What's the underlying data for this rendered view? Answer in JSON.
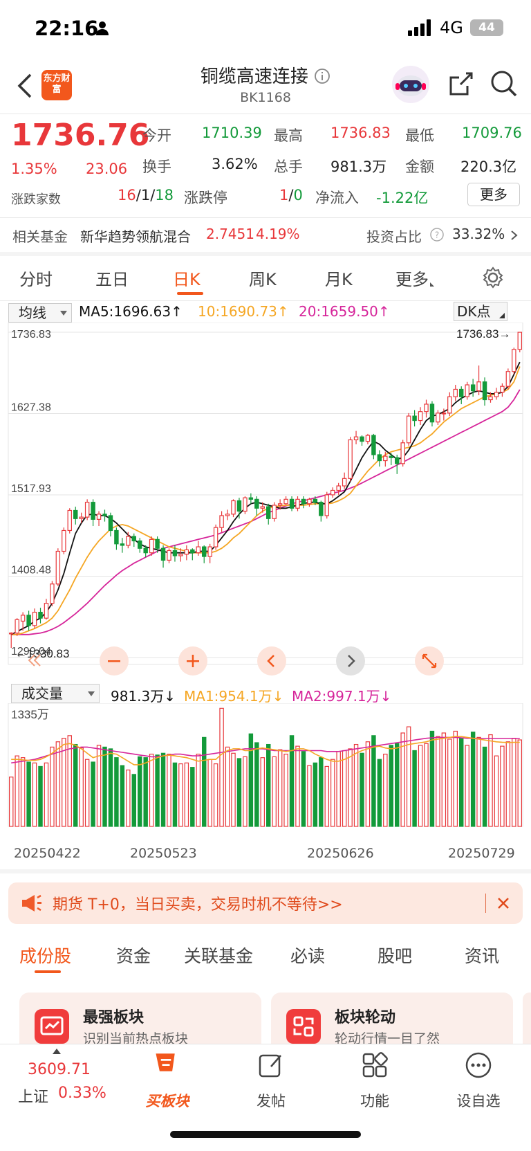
{
  "status_bar": {
    "time": "22:16",
    "network": "4G",
    "battery": "44"
  },
  "header": {
    "logo_text": "东方财富",
    "title": "铜缆高速连接",
    "code": "BK1168"
  },
  "quote": {
    "price": "1736.76",
    "change_pct": "1.35%",
    "change": "23.06",
    "open_label": "今开",
    "open": "1710.39",
    "high_label": "最高",
    "high": "1736.83",
    "low_label": "最低",
    "low": "1709.76",
    "turnover_label": "换手",
    "turnover": "3.62%",
    "volume_label": "总手",
    "volume": "981.3万",
    "amount_label": "金额",
    "amount": "220.3亿",
    "breadth_label": "涨跌家数",
    "breadth_up": "16",
    "breadth_flat": "1",
    "breadth_down": "18",
    "limit_label": "涨跌停",
    "limit_up": "1",
    "limit_down": "0",
    "netflow_label": "净流入",
    "netflow": "-1.22亿",
    "more_label": "更多"
  },
  "fund": {
    "label": "相关基金",
    "name": "新华趋势领航混合",
    "nav": "2.7451",
    "pct": "4.19%",
    "ratio_label": "投资占比",
    "ratio": "33.32%"
  },
  "tabs": [
    "分时",
    "五日",
    "日K",
    "周K",
    "月K",
    "更多"
  ],
  "active_tab": 2,
  "ma": {
    "selector": "均线",
    "ma5": "MA5:1696.63↑",
    "ma10": "10:1690.73↑",
    "ma20": "20:1659.50↑",
    "dk": "DK点"
  },
  "axis": {
    "y_ticks": [
      "1736.83",
      "1627.38",
      "1517.93",
      "1408.48",
      "1299.04"
    ],
    "max_marker": "1736.83→",
    "min_marker": "←1330.83"
  },
  "vol_panel": {
    "selector": "成交量",
    "vol": "981.3万↓",
    "ma1": "MA1:954.1万↓",
    "ma2": "MA2:997.1万↓",
    "max_label": "1335万"
  },
  "dates": [
    "20250422",
    "20250523",
    "20250626",
    "20250729"
  ],
  "banner": {
    "text": "期货 T+0，当日买卖，交易时机不等待>>"
  },
  "bottom_tabs": [
    "成份股",
    "资金",
    "关联基金",
    "必读",
    "股吧",
    "资讯"
  ],
  "cards": [
    {
      "title": "最强板块",
      "sub": "识别当前热点板块"
    },
    {
      "title": "板块轮动",
      "sub": "轮动行情一目了然"
    }
  ],
  "bottom_nav": {
    "index_value": "3609.71",
    "index_name": "上证",
    "index_pct": "0.33%",
    "items": [
      "买板块",
      "发帖",
      "功能",
      "设自选"
    ]
  },
  "colors": {
    "up": "#e8373a",
    "down": "#139a3a",
    "accent": "#f2571c",
    "ma5": "#111111",
    "ma10": "#f5a623",
    "ma20": "#d6259a"
  },
  "chart_data": {
    "type": "candlestick",
    "ylim": [
      1299.04,
      1736.83
    ],
    "ma_series_names": [
      "MA5",
      "MA10",
      "MA20"
    ],
    "candles": [
      [
        1330.83,
        1332,
        1312,
        1333
      ],
      [
        1332,
        1350,
        1328,
        1352
      ],
      [
        1348,
        1356,
        1335,
        1360
      ],
      [
        1356,
        1342,
        1335,
        1362
      ],
      [
        1342,
        1360,
        1338,
        1365
      ],
      [
        1360,
        1352,
        1345,
        1366
      ],
      [
        1352,
        1372,
        1350,
        1378
      ],
      [
        1372,
        1398,
        1368,
        1402
      ],
      [
        1398,
        1442,
        1395,
        1446
      ],
      [
        1442,
        1470,
        1438,
        1474
      ],
      [
        1470,
        1497,
        1466,
        1500
      ],
      [
        1497,
        1486,
        1478,
        1502
      ],
      [
        1486,
        1488,
        1480,
        1494
      ],
      [
        1488,
        1508,
        1484,
        1512
      ],
      [
        1508,
        1485,
        1476,
        1512
      ],
      [
        1485,
        1492,
        1476,
        1496
      ],
      [
        1492,
        1490,
        1482,
        1498
      ],
      [
        1490,
        1470,
        1462,
        1494
      ],
      [
        1470,
        1452,
        1444,
        1474
      ],
      [
        1452,
        1450,
        1440,
        1460
      ],
      [
        1450,
        1462,
        1446,
        1468
      ],
      [
        1462,
        1456,
        1448,
        1466
      ],
      [
        1456,
        1446,
        1440,
        1460
      ],
      [
        1446,
        1440,
        1434,
        1450
      ],
      [
        1440,
        1458,
        1436,
        1462
      ],
      [
        1458,
        1446,
        1440,
        1462
      ],
      [
        1446,
        1430,
        1420,
        1450
      ],
      [
        1430,
        1443,
        1426,
        1446
      ],
      [
        1443,
        1436,
        1428,
        1450
      ],
      [
        1436,
        1438,
        1428,
        1446
      ],
      [
        1438,
        1444,
        1430,
        1450
      ],
      [
        1444,
        1440,
        1430,
        1446
      ],
      [
        1440,
        1448,
        1436,
        1456
      ],
      [
        1448,
        1435,
        1426,
        1450
      ],
      [
        1435,
        1448,
        1426,
        1452
      ],
      [
        1448,
        1474,
        1444,
        1478
      ],
      [
        1474,
        1490,
        1468,
        1496
      ],
      [
        1490,
        1492,
        1484,
        1498
      ],
      [
        1492,
        1510,
        1488,
        1512
      ],
      [
        1510,
        1496,
        1486,
        1514
      ],
      [
        1496,
        1514,
        1492,
        1516
      ],
      [
        1514,
        1512,
        1506,
        1520
      ],
      [
        1512,
        1500,
        1490,
        1516
      ],
      [
        1500,
        1502,
        1494,
        1508
      ],
      [
        1502,
        1486,
        1478,
        1506
      ],
      [
        1486,
        1504,
        1482,
        1508
      ],
      [
        1504,
        1506,
        1498,
        1512
      ],
      [
        1506,
        1512,
        1504,
        1516
      ],
      [
        1512,
        1500,
        1496,
        1516
      ],
      [
        1500,
        1512,
        1496,
        1516
      ],
      [
        1512,
        1506,
        1500,
        1516
      ],
      [
        1506,
        1512,
        1502,
        1514
      ],
      [
        1512,
        1508,
        1504,
        1516
      ],
      [
        1508,
        1490,
        1482,
        1510
      ],
      [
        1490,
        1518,
        1486,
        1522
      ],
      [
        1518,
        1524,
        1514,
        1528
      ],
      [
        1524,
        1530,
        1518,
        1534
      ],
      [
        1530,
        1540,
        1526,
        1548
      ],
      [
        1540,
        1592,
        1536,
        1596
      ],
      [
        1592,
        1596,
        1586,
        1604
      ],
      [
        1596,
        1590,
        1584,
        1598
      ],
      [
        1590,
        1598,
        1586,
        1600
      ],
      [
        1598,
        1572,
        1566,
        1600
      ],
      [
        1572,
        1564,
        1556,
        1578
      ],
      [
        1564,
        1570,
        1556,
        1576
      ],
      [
        1570,
        1568,
        1558,
        1574
      ],
      [
        1568,
        1560,
        1546,
        1572
      ],
      [
        1560,
        1588,
        1556,
        1592
      ],
      [
        1588,
        1624,
        1584,
        1628
      ],
      [
        1624,
        1618,
        1610,
        1632
      ],
      [
        1618,
        1630,
        1612,
        1636
      ],
      [
        1630,
        1640,
        1622,
        1646
      ],
      [
        1640,
        1616,
        1610,
        1644
      ],
      [
        1616,
        1628,
        1612,
        1632
      ],
      [
        1628,
        1628,
        1618,
        1634
      ],
      [
        1628,
        1650,
        1624,
        1656
      ],
      [
        1650,
        1660,
        1644,
        1666
      ],
      [
        1660,
        1650,
        1640,
        1664
      ],
      [
        1650,
        1666,
        1646,
        1670
      ],
      [
        1666,
        1658,
        1650,
        1674
      ],
      [
        1658,
        1670,
        1652,
        1692
      ],
      [
        1670,
        1646,
        1638,
        1676
      ],
      [
        1646,
        1650,
        1642,
        1656
      ],
      [
        1650,
        1656,
        1646,
        1662
      ],
      [
        1656,
        1664,
        1650,
        1668
      ],
      [
        1664,
        1684,
        1660,
        1688
      ],
      [
        1684,
        1713.7,
        1680,
        1716
      ],
      [
        1713.7,
        1736.76,
        1709.76,
        1736.83
      ]
    ],
    "ma5": [
      1330,
      1334,
      1338,
      1342,
      1348,
      1352,
      1360,
      1372,
      1390,
      1412,
      1440,
      1466,
      1480,
      1491,
      1492,
      1490,
      1490,
      1486,
      1480,
      1472,
      1464,
      1458,
      1452,
      1448,
      1446,
      1444,
      1442,
      1440,
      1440,
      1440,
      1440,
      1440,
      1442,
      1442,
      1442,
      1450,
      1460,
      1470,
      1482,
      1492,
      1500,
      1506,
      1508,
      1506,
      1504,
      1502,
      1500,
      1500,
      1502,
      1504,
      1506,
      1508,
      1508,
      1506,
      1506,
      1510,
      1516,
      1522,
      1536,
      1552,
      1568,
      1580,
      1590,
      1586,
      1578,
      1572,
      1566,
      1568,
      1578,
      1592,
      1606,
      1618,
      1624,
      1626,
      1630,
      1634,
      1642,
      1648,
      1652,
      1656,
      1658,
      1656,
      1654,
      1654,
      1656,
      1664,
      1680,
      1696.63
    ],
    "ma10": [
      1330,
      1330,
      1332,
      1335,
      1338,
      1342,
      1346,
      1352,
      1362,
      1376,
      1390,
      1406,
      1420,
      1434,
      1446,
      1456,
      1464,
      1472,
      1476,
      1478,
      1476,
      1472,
      1468,
      1464,
      1460,
      1456,
      1452,
      1448,
      1446,
      1444,
      1442,
      1440,
      1440,
      1440,
      1440,
      1442,
      1446,
      1452,
      1460,
      1466,
      1474,
      1482,
      1490,
      1496,
      1500,
      1502,
      1503,
      1504,
      1504,
      1504,
      1504,
      1505,
      1506,
      1506,
      1506,
      1507,
      1510,
      1514,
      1520,
      1530,
      1540,
      1550,
      1558,
      1566,
      1572,
      1576,
      1578,
      1580,
      1582,
      1584,
      1588,
      1594,
      1600,
      1608,
      1616,
      1622,
      1628,
      1634,
      1638,
      1642,
      1646,
      1650,
      1652,
      1654,
      1656,
      1660,
      1670,
      1690.73
    ],
    "ma20": [
      1330,
      1330,
      1330,
      1330,
      1331,
      1332,
      1334,
      1337,
      1341,
      1346,
      1352,
      1358,
      1365,
      1372,
      1380,
      1388,
      1396,
      1403,
      1410,
      1416,
      1421,
      1426,
      1430,
      1434,
      1438,
      1442,
      1446,
      1448,
      1450,
      1452,
      1454,
      1456,
      1458,
      1460,
      1462,
      1464,
      1467,
      1470,
      1473,
      1476,
      1479,
      1482,
      1486,
      1490,
      1494,
      1497,
      1500,
      1503,
      1506,
      1508,
      1510,
      1512,
      1514,
      1516,
      1518,
      1520,
      1522,
      1524,
      1527,
      1530,
      1534,
      1538,
      1542,
      1546,
      1550,
      1554,
      1558,
      1562,
      1566,
      1570,
      1574,
      1578,
      1582,
      1586,
      1590,
      1594,
      1598,
      1602,
      1606,
      1610,
      1614,
      1618,
      1622,
      1626,
      1630,
      1636,
      1646,
      1659.5
    ],
    "volume_max": 1335,
    "volumes": [
      560,
      800,
      780,
      730,
      720,
      680,
      720,
      900,
      960,
      1000,
      1030,
      930,
      890,
      760,
      730,
      920,
      900,
      880,
      780,
      690,
      640,
      590,
      790,
      780,
      820,
      810,
      830,
      820,
      720,
      710,
      720,
      670,
      820,
      1010,
      760,
      710,
      1340,
      900,
      830,
      770,
      790,
      1050,
      950,
      780,
      930,
      790,
      870,
      820,
      1030,
      910,
      850,
      690,
      720,
      780,
      680,
      760,
      850,
      860,
      880,
      930,
      830,
      960,
      1030,
      760,
      820,
      920,
      940,
      1060,
      1130,
      860,
      920,
      940,
      1080,
      1020,
      1060,
      990,
      1080,
      1000,
      920,
      1070,
      1010,
      900,
      1040,
      800,
      910,
      960,
      1000,
      981.3
    ],
    "vol_ma1": [
      760,
      760,
      755,
      750,
      748,
      760,
      790,
      830,
      880,
      930,
      940,
      920,
      880,
      830,
      780,
      800,
      810,
      830,
      820,
      780,
      740,
      700,
      700,
      720,
      750,
      780,
      800,
      810,
      800,
      790,
      780,
      760,
      740,
      750,
      760,
      760,
      820,
      860,
      880,
      880,
      860,
      860,
      880,
      890,
      880,
      870,
      860,
      850,
      860,
      880,
      880,
      860,
      820,
      790,
      760,
      740,
      740,
      760,
      790,
      830,
      860,
      880,
      900,
      910,
      890,
      880,
      890,
      910,
      930,
      940,
      950,
      960,
      980,
      990,
      1000,
      1010,
      1020,
      1020,
      1010,
      1000,
      990,
      980,
      970,
      960,
      955,
      952,
      953,
      954.1
    ],
    "vol_ma2": [
      720,
      730,
      740,
      750,
      760,
      780,
      800,
      820,
      840,
      860,
      880,
      890,
      900,
      900,
      890,
      880,
      870,
      860,
      850,
      840,
      830,
      820,
      810,
      800,
      790,
      790,
      800,
      810,
      820,
      820,
      810,
      800,
      800,
      810,
      820,
      830,
      840,
      850,
      860,
      870,
      880,
      880,
      880,
      880,
      870,
      860,
      860,
      860,
      860,
      860,
      860,
      860,
      860,
      860,
      850,
      850,
      850,
      860,
      870,
      880,
      890,
      900,
      910,
      920,
      930,
      940,
      950,
      960,
      970,
      980,
      990,
      1000,
      1005,
      1010,
      1010,
      1010,
      1010,
      1005,
      1000,
      1000,
      998,
      997,
      997,
      997,
      997,
      997,
      997,
      997.1
    ]
  }
}
